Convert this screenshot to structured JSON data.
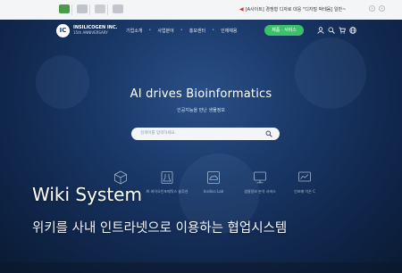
{
  "browser": {
    "notice_text": "[A사이트] 경쟁형 디자로 대응 \"디지털 박테움] 일반~",
    "nav_prev": "‹",
    "nav_next": "›"
  },
  "header": {
    "logo_mark": "IC",
    "logo_name": "INSILICOGEN INC.",
    "logo_tagline": "15th ANNIVERSARY",
    "menu": [
      "기업소개",
      "사업분야",
      "홍보센터",
      "인재채용"
    ],
    "cta_label": "제품 · 서비스"
  },
  "hero": {
    "title": "AI drives Bioinformatics",
    "subtitle": "인공지능을 만난 생물정보",
    "search_placeholder": "검색어를 입력하세요."
  },
  "categories": [
    {
      "label": "",
      "icon": "cube-icon"
    },
    {
      "label": "AI 바이오인포매틱스 솔루션",
      "icon": "flask-icon"
    },
    {
      "label": "Insilico Lab",
      "icon": "cloud-icon"
    },
    {
      "label": "생물정보 분석 서비스",
      "icon": "monitor-icon"
    },
    {
      "label": "인포매 이온 C",
      "icon": "screen-chart-icon"
    }
  ],
  "overlay": {
    "title": "Wiki System",
    "subtitle": "위키를 사내 인트라넷으로 이용하는 협업시스템"
  },
  "colors": {
    "accent_green": "#3cc16a",
    "hero_bg": "#183665"
  }
}
